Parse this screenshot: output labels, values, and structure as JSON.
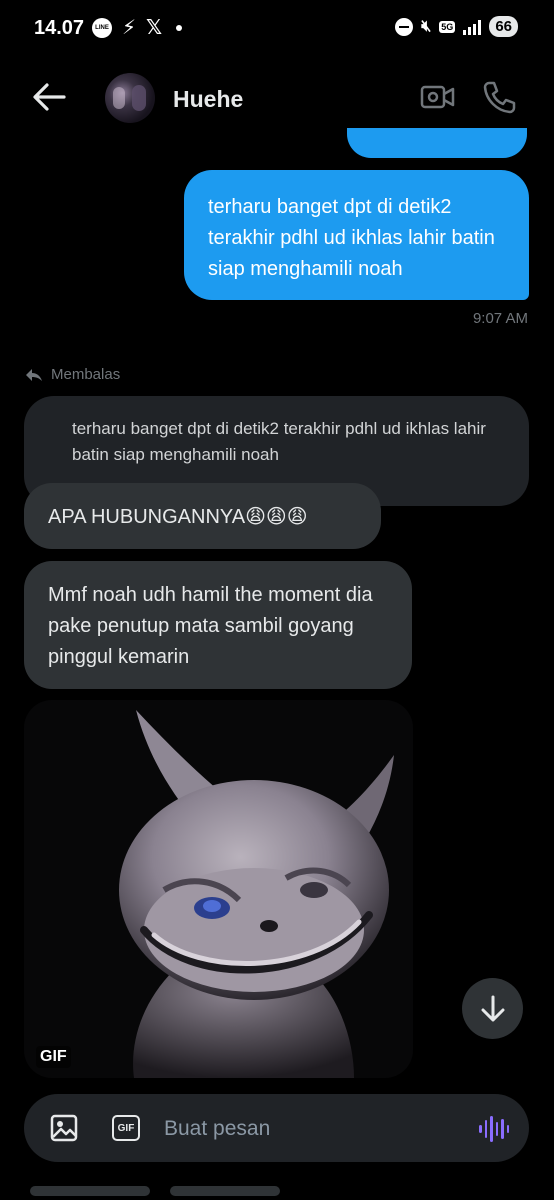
{
  "status_bar": {
    "time": "14.07",
    "line_label": "LINE",
    "network": "5G",
    "battery": "66"
  },
  "header": {
    "contact_name": "Huehe"
  },
  "messages": {
    "sent": {
      "text": "terharu banget dpt di detik2 terakhir pdhl ud ikhlas lahir batin siap menghamili noah",
      "time": "9:07 AM"
    },
    "reply_label": "Membalas",
    "quoted_text": "terharu banget dpt di detik2 terakhir pdhl ud ikhlas lahir batin siap menghamili noah",
    "received": [
      {
        "text": "APA HUBUNGANNYA😩😩😩"
      },
      {
        "text": "Mmf noah udh hamil the moment dia pake penutup mata sambil goyang pinggul kemarin"
      }
    ],
    "gif_badge": "GIF"
  },
  "composer": {
    "gif_label": "GIF",
    "placeholder": "Buat pesan"
  },
  "colors": {
    "sent_bubble": "#1d9bf0",
    "received_bubble": "#2f3336",
    "quoted_bubble": "#202327",
    "voice_accent": "#8a6dff"
  }
}
